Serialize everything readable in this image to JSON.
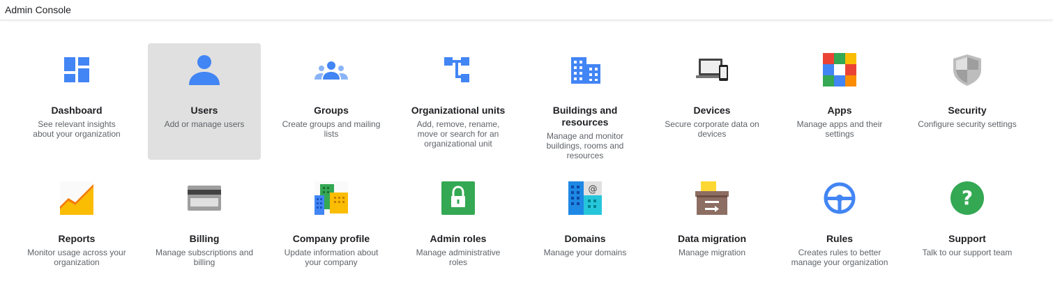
{
  "header": {
    "title": "Admin Console"
  },
  "cards": [
    {
      "name": "dashboard",
      "title": "Dashboard",
      "desc": "See relevant insights about your organization",
      "icon": "dashboard-icon"
    },
    {
      "name": "users",
      "title": "Users",
      "desc": "Add or manage users",
      "icon": "user-icon",
      "selected": true
    },
    {
      "name": "groups",
      "title": "Groups",
      "desc": "Create groups and mailing lists",
      "icon": "groups-icon"
    },
    {
      "name": "organizational-units",
      "title": "Organizational units",
      "desc": "Add, remove, rename, move or search for an organizational unit",
      "icon": "org-tree-icon"
    },
    {
      "name": "buildings-and-resources",
      "title": "Buildings and resources",
      "desc": "Manage and monitor buildings, rooms and resources",
      "icon": "building-icon"
    },
    {
      "name": "devices",
      "title": "Devices",
      "desc": "Secure corporate data on devices",
      "icon": "devices-icon"
    },
    {
      "name": "apps",
      "title": "Apps",
      "desc": "Manage apps and their settings",
      "icon": "apps-grid-icon"
    },
    {
      "name": "security",
      "title": "Security",
      "desc": "Configure security settings",
      "icon": "shield-icon"
    },
    {
      "name": "reports",
      "title": "Reports",
      "desc": "Monitor usage across your organization",
      "icon": "reports-chart-icon"
    },
    {
      "name": "billing",
      "title": "Billing",
      "desc": "Manage subscriptions and billing",
      "icon": "credit-card-icon"
    },
    {
      "name": "company-profile",
      "title": "Company profile",
      "desc": "Update information about your company",
      "icon": "company-buildings-icon"
    },
    {
      "name": "admin-roles",
      "title": "Admin roles",
      "desc": "Manage administrative roles",
      "icon": "lock-icon"
    },
    {
      "name": "domains",
      "title": "Domains",
      "desc": "Manage your domains",
      "icon": "domains-icon"
    },
    {
      "name": "data-migration",
      "title": "Data migration",
      "desc": "Manage migration",
      "icon": "migration-box-icon"
    },
    {
      "name": "rules",
      "title": "Rules",
      "desc": "Creates rules to better manage your organization",
      "icon": "steering-wheel-icon"
    },
    {
      "name": "support",
      "title": "Support",
      "desc": "Talk to our support team",
      "icon": "help-icon"
    }
  ],
  "colors": {
    "blue": "#4285f4",
    "green": "#34a853",
    "yellow": "#fbbc04",
    "red": "#ea4335",
    "selected_bg": "#e0e0e0"
  }
}
